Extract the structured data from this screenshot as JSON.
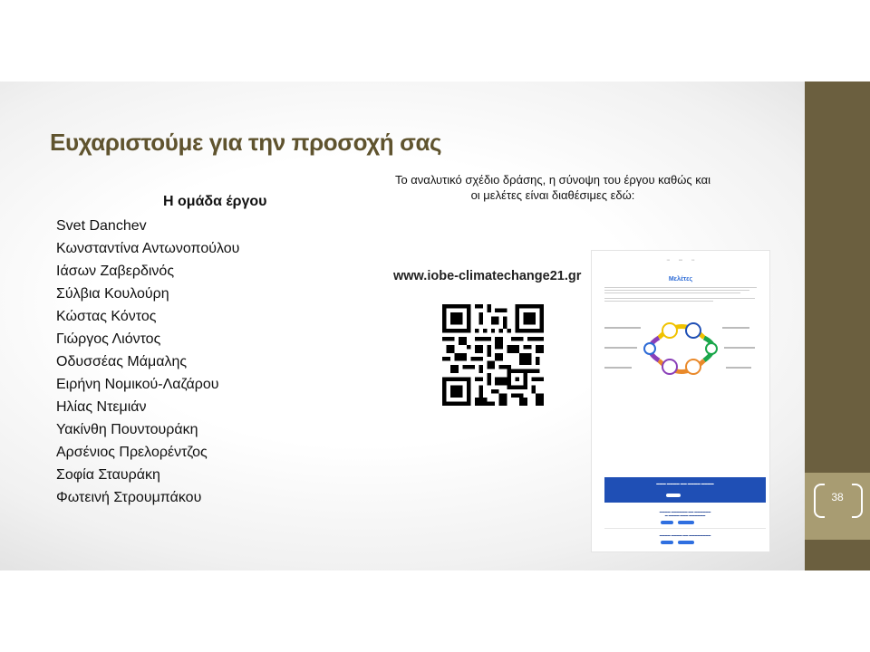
{
  "slide": {
    "title": "Ευχαριστούμε για την προσοχή σας",
    "page_number": "38",
    "sidebar_color": "#6b5f3f",
    "badge_color": "#a89c72",
    "title_color": "#5f532e"
  },
  "team": {
    "heading": "Η ομάδα έργου",
    "members": [
      "Svet Danchev",
      "Κωνσταντίνα Αντωνοπούλου",
      "Ιάσων Ζαβερδινός",
      "Σύλβια Κουλούρη",
      "Κώστας Κόντος",
      "Γιώργος Λιόντος",
      "Οδυσσέας Μάμαλης",
      "Ειρήνη Νομικού-Λαζάρου",
      "Ηλίας Ντεμιάν",
      "Υακίνθη Πουντουράκη",
      "Αρσένιος Πρελορέντζος",
      "Σοφία Σταυράκη",
      "Φωτεινή Στρουμπάκου"
    ]
  },
  "info": {
    "description_line1": "Το αναλυτικό σχέδιο δράσης, η σύνοψη του έργου καθώς και",
    "description_line2": "οι μελέτες είναι διαθέσιμες εδώ:",
    "website": "www.iobe-climatechange21.gr"
  },
  "website_screenshot": {
    "page_title": "Μελέτες",
    "accent_color": "#2d6bd6"
  }
}
